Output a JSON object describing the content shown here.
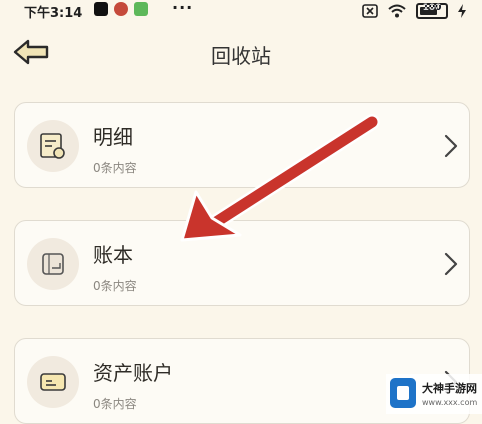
{
  "status_bar": {
    "time": "下午3:14",
    "battery": "100"
  },
  "header": {
    "title": "回收站"
  },
  "cards": [
    {
      "name": "明细",
      "count": "0条内容",
      "icon": "receipt-icon"
    },
    {
      "name": "账本",
      "count": "0条内容",
      "icon": "ledger-book-icon"
    },
    {
      "name": "资产账户",
      "count": "0条内容",
      "icon": "card-wallet-icon"
    }
  ],
  "watermark": {
    "title": "大神手游网",
    "url": "www.xxx.com"
  },
  "colors": {
    "background": "#fbf6ea",
    "accent": "#f0e4b6",
    "annotation_arrow": "#c9342c"
  }
}
